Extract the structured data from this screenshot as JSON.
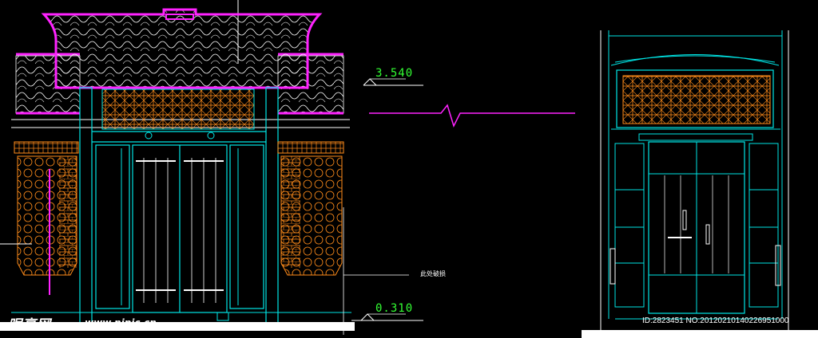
{
  "drawing": {
    "elevation_top": "3.540",
    "elevation_bottom": "0.310",
    "note": "此处破损"
  },
  "watermark": {
    "logo": "昵享网",
    "url": "www.nipic.cn",
    "id_stamp": "ID:2823451 NO:20120210140226951000"
  },
  "colors": {
    "background": "#000000",
    "outline": "#00e5e5",
    "roof_magenta": "#ff22ff",
    "lattice_orange": "#ff8c1a",
    "text_green": "#33ff33",
    "white": "#ffffff"
  }
}
